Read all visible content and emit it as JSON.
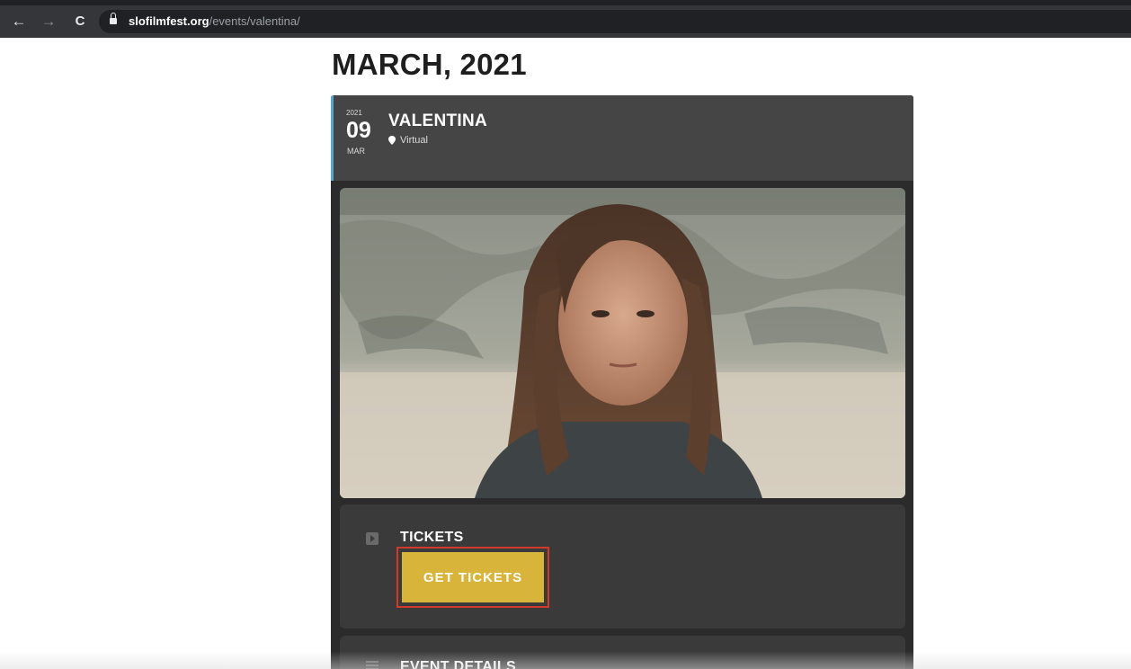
{
  "browser": {
    "nav": {
      "back_icon": "←",
      "forward_icon": "→",
      "reload_icon": "C"
    },
    "url": {
      "host": "slofilmfest.org",
      "path": "/events/valentina/"
    }
  },
  "page": {
    "month_heading": "MARCH, 2021",
    "event": {
      "year": "2021",
      "day": "09",
      "month": "MAR",
      "title": "VALENTINA",
      "venue": "Virtual"
    },
    "image": {
      "subject": "film-still-girl-long-hair"
    },
    "tickets": {
      "title": "TICKETS",
      "button_label": "GET TICKETS"
    },
    "details": {
      "title": "EVENT DETAILS"
    }
  },
  "colors": {
    "header_bg": "#454545",
    "accent_bar": "#5aa6c4",
    "button_gold": "#d8b43b",
    "highlight_red": "#d1392b"
  }
}
